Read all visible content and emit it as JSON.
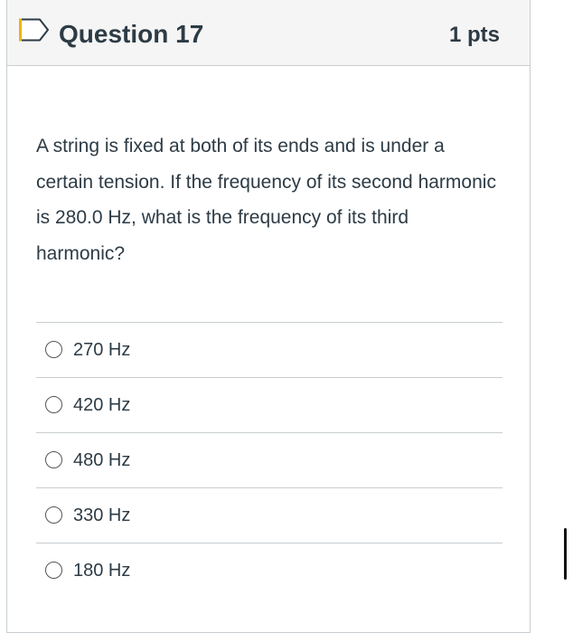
{
  "question": {
    "title": "Question 17",
    "points": "1 pts",
    "text": "A string is fixed at both of its ends and is under a certain tension. If the frequency of its second harmonic is 280.0 Hz, what is the frequency of its third harmonic?",
    "flag_icon": "flag-icon"
  },
  "answers": [
    {
      "label": "270 Hz",
      "selected": false
    },
    {
      "label": "420 Hz",
      "selected": false
    },
    {
      "label": "480 Hz",
      "selected": false
    },
    {
      "label": "330 Hz",
      "selected": false
    },
    {
      "label": "180 Hz",
      "selected": false
    }
  ]
}
